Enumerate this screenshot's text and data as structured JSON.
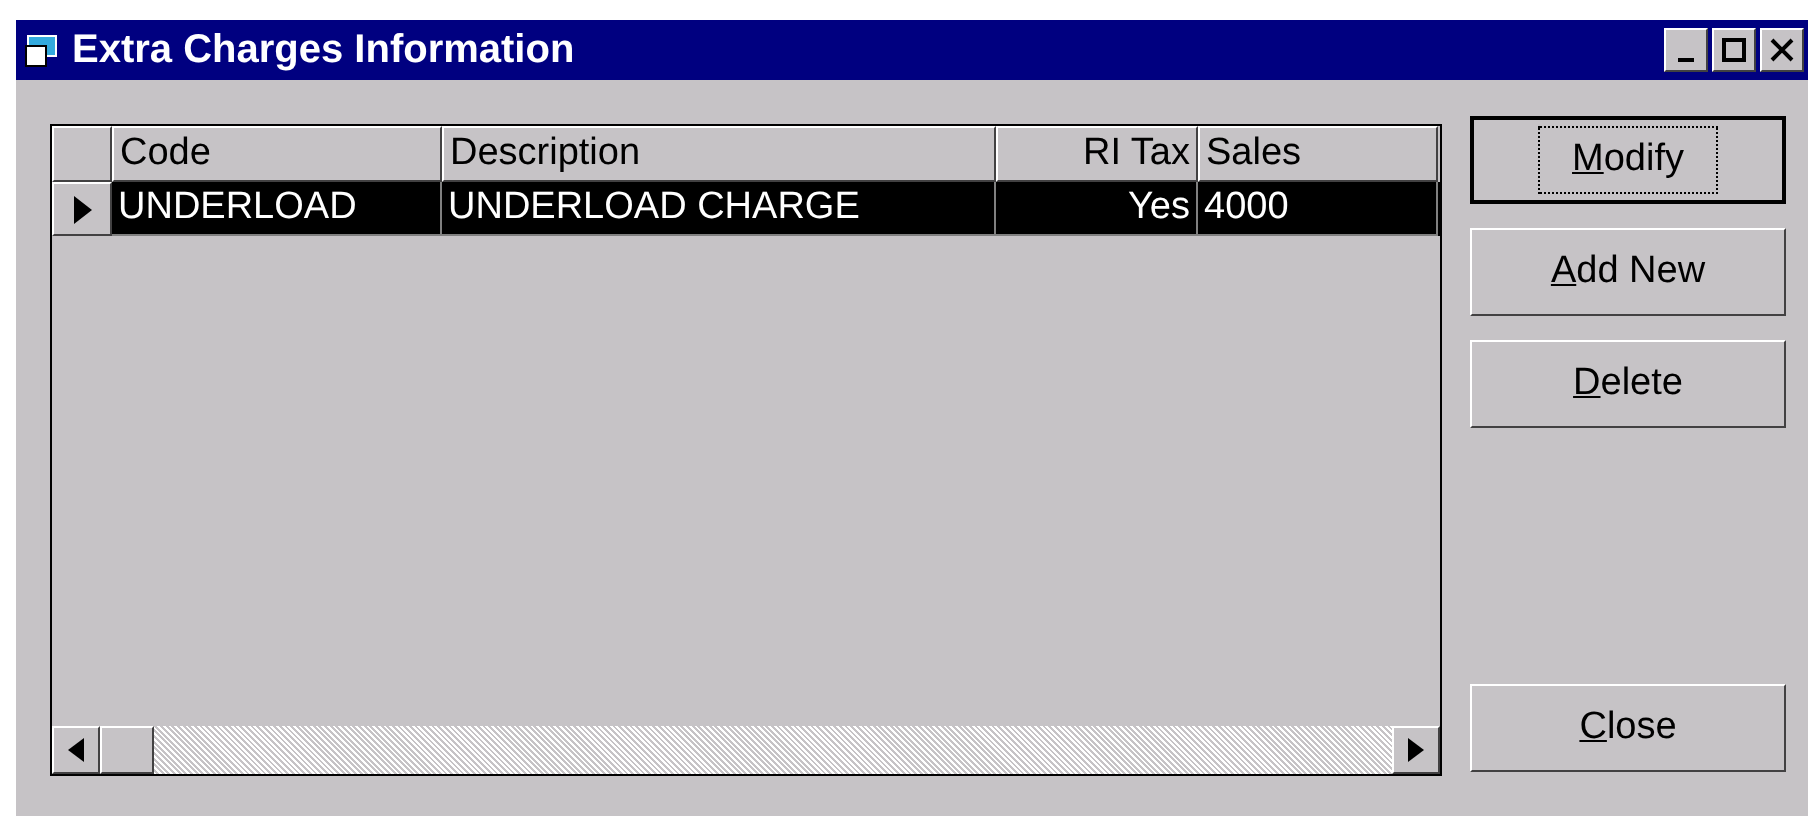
{
  "window": {
    "title": "Extra Charges Information"
  },
  "table": {
    "columns": [
      {
        "label": "Code",
        "kind": "text"
      },
      {
        "label": "Description",
        "kind": "text"
      },
      {
        "label": "RI Tax",
        "kind": "number"
      },
      {
        "label": "Sales",
        "kind": "text"
      }
    ],
    "rows": [
      {
        "cells": [
          "UNDERLOAD",
          "UNDERLOAD CHARGE",
          "Yes",
          "4000"
        ],
        "selected": true,
        "current": true
      }
    ]
  },
  "buttons": [
    {
      "key": "M",
      "rest": "odify",
      "default": true
    },
    {
      "key": "A",
      "rest": "dd New",
      "default": false
    },
    {
      "key": "D",
      "rest": "elete",
      "default": false
    },
    {
      "key": "C",
      "rest": "lose",
      "default": false
    }
  ]
}
